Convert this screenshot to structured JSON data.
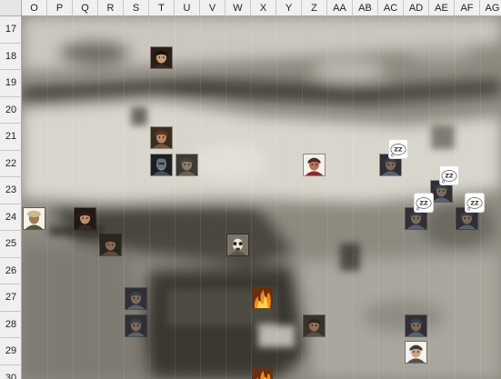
{
  "sheet": {
    "columns": [
      "O",
      "P",
      "Q",
      "R",
      "S",
      "T",
      "U",
      "V",
      "W",
      "X",
      "Y",
      "Z",
      "AA",
      "AB",
      "AC",
      "AD",
      "AE",
      "AF",
      "AG"
    ],
    "rows": [
      "17",
      "18",
      "19",
      "20",
      "21",
      "22",
      "23",
      "24",
      "25",
      "26",
      "27",
      "28",
      "29",
      "30"
    ]
  },
  "tokens": [
    {
      "name": "hooded-rogue-token-t18",
      "icon": "hooded-rogue-portrait",
      "cell": "T18"
    },
    {
      "name": "dwarf-warrior-token-t21",
      "icon": "dwarf-warrior-portrait",
      "cell": "T21"
    },
    {
      "name": "armored-knight-token-t22",
      "icon": "dark-knight-portrait",
      "cell": "T22"
    },
    {
      "name": "orc-brute-token-u22",
      "icon": "orc-brute-portrait",
      "cell": "U22"
    },
    {
      "name": "ogre-chief-token-z22",
      "icon": "ogre-chief-portrait",
      "cell": "Z22"
    },
    {
      "name": "sleeping-goblin-token-ac22",
      "icon": "goblin-portrait",
      "cell": "AC22",
      "status": "sleeping"
    },
    {
      "name": "sleeping-goblin-token-ae23",
      "icon": "goblin-portrait",
      "cell": "AE23",
      "status": "sleeping"
    },
    {
      "name": "sleeping-goblin-token-ad24",
      "icon": "goblin-portrait",
      "cell": "AD24",
      "status": "sleeping"
    },
    {
      "name": "sleeping-goblin-token-af24",
      "icon": "goblin-portrait",
      "cell": "AF24",
      "status": "sleeping"
    },
    {
      "name": "turbaned-warrior-token-o24",
      "icon": "turbaned-warrior-portrait",
      "cell": "O24"
    },
    {
      "name": "bearded-ranger-token-q24",
      "icon": "bearded-ranger-portrait",
      "cell": "Q24"
    },
    {
      "name": "dwarf-fighter-token-r25",
      "icon": "dwarf-fighter-portrait",
      "cell": "R25"
    },
    {
      "name": "skeleton-token-w25",
      "icon": "skull-portrait",
      "cell": "W25"
    },
    {
      "name": "goblin-token-s27",
      "icon": "goblin-portrait",
      "cell": "S27"
    },
    {
      "name": "goblin-token-s28",
      "icon": "goblin-portrait",
      "cell": "S28"
    },
    {
      "name": "fire-token-x27",
      "icon": "fire-icon",
      "cell": "X27"
    },
    {
      "name": "ogre-token-z28",
      "icon": "ogre-portrait",
      "cell": "Z28"
    },
    {
      "name": "goblin-token-ad28",
      "icon": "goblin-portrait",
      "cell": "AD28"
    },
    {
      "name": "hooded-cleric-token-ad29",
      "icon": "hooded-cleric-portrait",
      "cell": "AD29"
    },
    {
      "name": "fire-token-x30",
      "icon": "fire-icon",
      "cell": "X30"
    }
  ],
  "colors": {
    "header_bg": "#f0f0f0",
    "gridline": "#c6c6c6",
    "map_stone": "#9a978c",
    "map_shadow": "#2f2d29",
    "map_light": "#d7d5cc"
  }
}
